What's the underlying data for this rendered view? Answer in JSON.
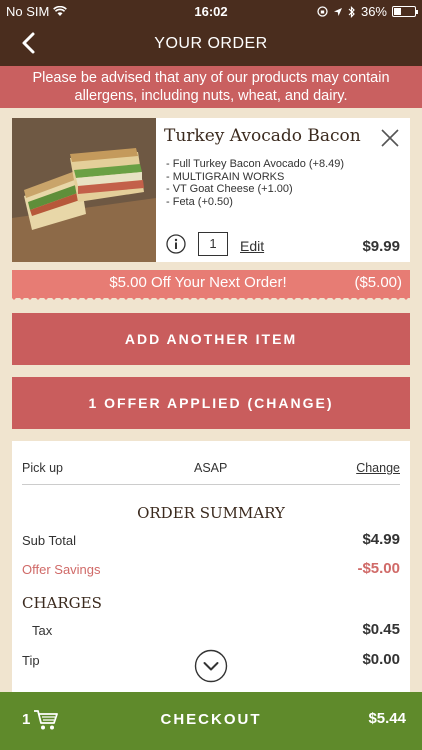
{
  "status_bar": {
    "carrier": "No SIM",
    "time": "16:02",
    "battery": "36%",
    "battery_level": 0.36
  },
  "nav": {
    "title": "YOUR ORDER",
    "back_icon": "chevron-left-icon"
  },
  "allergen_notice": "Please be advised that any of our products may contain allergens, including nuts, wheat, and dairy.",
  "item": {
    "name": "Turkey Avocado Bacon",
    "modifiers": [
      "- Full Turkey Bacon Avocado (+8.49)",
      "- MULTIGRAIN WORKS",
      "- VT Goat Cheese (+1.00)",
      "- Feta (+0.50)"
    ],
    "quantity": "1",
    "edit_label": "Edit",
    "price": "$9.99"
  },
  "offer": {
    "label": "$5.00 Off Your Next Order!",
    "amount": "($5.00)"
  },
  "buttons": {
    "add_item": "ADD ANOTHER ITEM",
    "offer_applied": "1 OFFER APPLIED (CHANGE)"
  },
  "pickup": {
    "label": "Pick up",
    "time": "ASAP",
    "change_label": "Change"
  },
  "summary": {
    "title": "ORDER SUMMARY",
    "subtotal_label": "Sub Total",
    "subtotal": "$4.99",
    "savings_label": "Offer Savings",
    "savings": "-$5.00",
    "charges_title": "CHARGES",
    "tax_label": "Tax",
    "tax": "$0.45",
    "tip_label": "Tip",
    "tip": "$0.00"
  },
  "footer": {
    "cart_count": "1",
    "checkout_label": "CHECKOUT",
    "total": "$5.44"
  },
  "colors": {
    "brown": "#4a2d1e",
    "red": "#c95d5d",
    "green": "#5f8a2b",
    "cream": "#f0e4cf"
  }
}
